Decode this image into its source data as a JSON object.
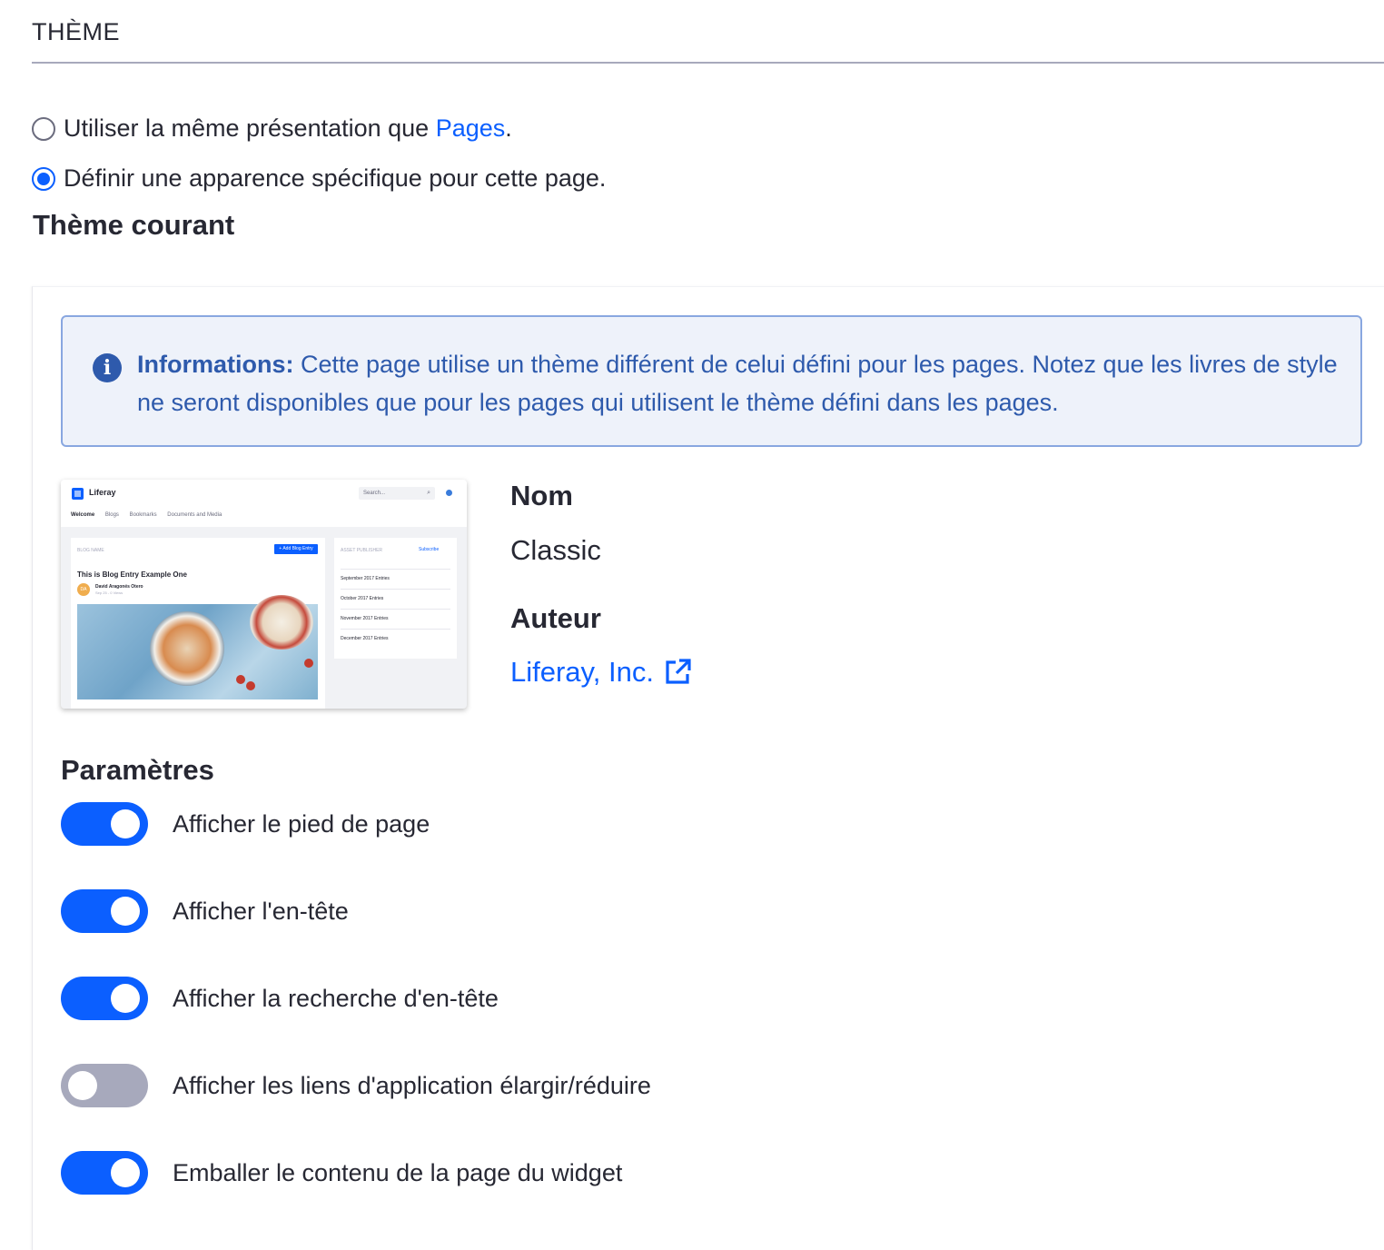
{
  "section": {
    "title": "THÈME"
  },
  "layout_options": [
    {
      "label_before": "Utiliser la même présentation que ",
      "link": "Pages",
      "label_after": ".",
      "checked": false
    },
    {
      "label": "Définir une apparence spécifique pour cette page.",
      "checked": true
    }
  ],
  "current_theme": {
    "heading": "Thème courant",
    "alert": {
      "icon": "info-circle-icon",
      "lead": "Informations:",
      "text": " Cette page utilise un thème différent de celui défini pour les pages. Notez que les livres de style ne seront disponibles que pour les pages qui utilisent le thème défini dans les pages."
    },
    "thumbnail": {
      "brand": "Liferay",
      "search": "Search...",
      "nav": [
        "Welcome",
        "Blogs",
        "Bookmarks",
        "Documents and Media"
      ],
      "blog_name": "BLOG NAME",
      "add_button": "+ Add Blog Entry",
      "entry_title": "This is Blog Entry Example One",
      "avatar": "DA",
      "author": "David Aragonés Otero",
      "date": "Sep 25 - 0 Views",
      "side_head": "ASSET PUBLISHER",
      "subscribe": "Subscribe",
      "entries": [
        "September 2017 Entries",
        "October 2017 Entries",
        "November 2017 Entries",
        "December 2017 Entries"
      ]
    },
    "name_label": "Nom",
    "name_value": "Classic",
    "author_label": "Auteur",
    "author_value": "Liferay, Inc.",
    "author_icon": "external-link-icon"
  },
  "settings": {
    "heading": "Paramètres",
    "toggles": [
      {
        "label": "Afficher le pied de page",
        "on": true
      },
      {
        "label": "Afficher l'en-tête",
        "on": true
      },
      {
        "label": "Afficher la recherche d'en-tête",
        "on": true
      },
      {
        "label": "Afficher les liens d'application élargir/réduire",
        "on": false
      },
      {
        "label": "Emballer le contenu de la page du widget",
        "on": true
      }
    ]
  },
  "colors": {
    "accent": "#0b5fff",
    "info": "#2e5aac",
    "toggle_off": "#a7a9bc"
  }
}
